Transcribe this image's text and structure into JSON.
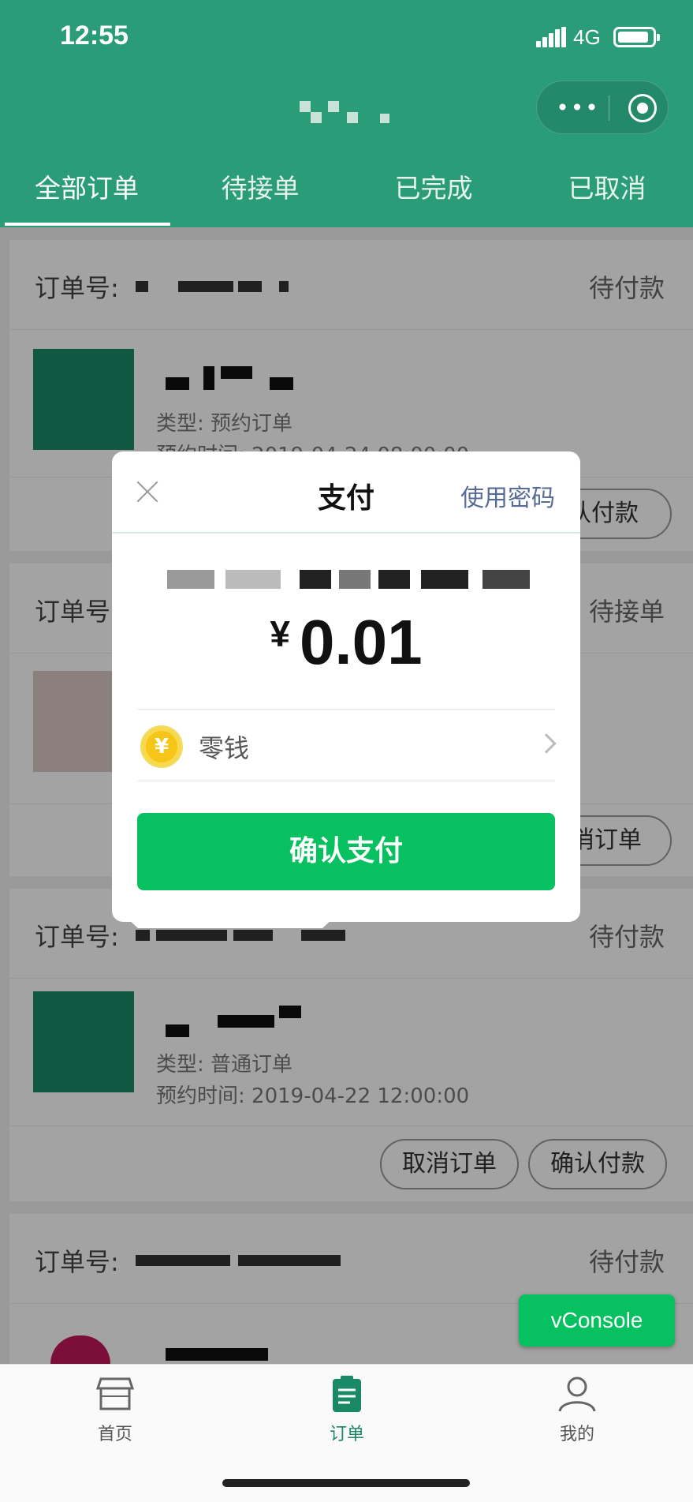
{
  "status_bar": {
    "time": "12:55",
    "network": "4G"
  },
  "tabs": [
    {
      "label": "全部订单",
      "active": true
    },
    {
      "label": "待接单",
      "active": false
    },
    {
      "label": "已完成",
      "active": false
    },
    {
      "label": "已取消",
      "active": false
    }
  ],
  "orders": [
    {
      "order_label": "订单号:",
      "status": "待付款",
      "type": "类型: 预约订单",
      "time": "预约时间: 2019-04-24 08:00:00",
      "actions": [
        "认付款"
      ]
    },
    {
      "order_label": "订单号",
      "status": "待接单",
      "actions": [
        "消订单"
      ]
    },
    {
      "order_label": "订单号:",
      "status": "待付款",
      "type": "类型: 普通订单",
      "time": "预约时间: 2019-04-22 12:00:00",
      "actions": [
        "取消订单",
        "确认付款"
      ]
    },
    {
      "order_label": "订单号:",
      "status": "待付款"
    }
  ],
  "payment": {
    "title": "支付",
    "use_password": "使用密码",
    "currency": "¥",
    "amount": "0.01",
    "method": "零钱",
    "coin_symbol": "¥",
    "confirm": "确认支付"
  },
  "vconsole": "vConsole",
  "tabbar": [
    {
      "label": "首页",
      "icon": "store-icon",
      "active": false
    },
    {
      "label": "订单",
      "icon": "clipboard-icon",
      "active": true
    },
    {
      "label": "我的",
      "icon": "person-icon",
      "active": false
    }
  ],
  "colors": {
    "brand": "#2a9d78",
    "pay_green": "#07c160",
    "link": "#576b95"
  }
}
